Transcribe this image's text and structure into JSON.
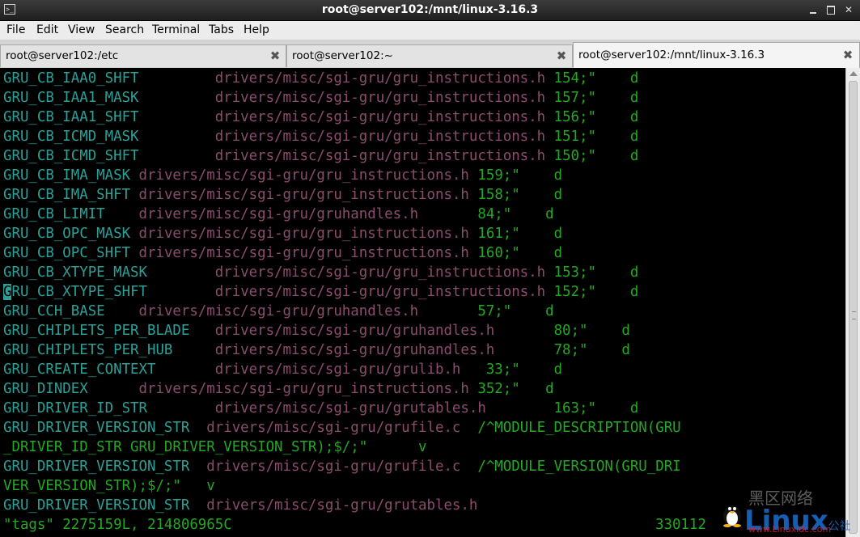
{
  "window": {
    "title": "root@server102:/mnt/linux-3.16.3"
  },
  "menu": {
    "items": [
      "File",
      "Edit",
      "View",
      "Search",
      "Terminal",
      "Tabs",
      "Help"
    ]
  },
  "tabs": [
    {
      "label": "root@server102:/etc",
      "active": false
    },
    {
      "label": "root@server102:~",
      "active": false
    },
    {
      "label": "root@server102:/mnt/linux-3.16.3",
      "active": true
    }
  ],
  "terminal": {
    "lines": [
      {
        "sym": "GRU_CB_IAA0_SHFT",
        "gap1": "         ",
        "file": "drivers/misc/sgi-gru/gru_instructions.h",
        "gap2": " ",
        "num": "154;\"",
        "gap3": "    ",
        "kind": "d"
      },
      {
        "sym": "GRU_CB_IAA1_MASK",
        "gap1": "         ",
        "file": "drivers/misc/sgi-gru/gru_instructions.h",
        "gap2": " ",
        "num": "157;\"",
        "gap3": "    ",
        "kind": "d"
      },
      {
        "sym": "GRU_CB_IAA1_SHFT",
        "gap1": "         ",
        "file": "drivers/misc/sgi-gru/gru_instructions.h",
        "gap2": " ",
        "num": "156;\"",
        "gap3": "    ",
        "kind": "d"
      },
      {
        "sym": "GRU_CB_ICMD_MASK",
        "gap1": "         ",
        "file": "drivers/misc/sgi-gru/gru_instructions.h",
        "gap2": " ",
        "num": "151;\"",
        "gap3": "    ",
        "kind": "d"
      },
      {
        "sym": "GRU_CB_ICMD_SHFT",
        "gap1": "         ",
        "file": "drivers/misc/sgi-gru/gru_instructions.h",
        "gap2": " ",
        "num": "150;\"",
        "gap3": "    ",
        "kind": "d"
      },
      {
        "sym": "GRU_CB_IMA_MASK",
        "gap1": " ",
        "file": "drivers/misc/sgi-gru/gru_instructions.h",
        "gap2": " ",
        "num": "159;\"",
        "gap3": "    ",
        "kind": "d"
      },
      {
        "sym": "GRU_CB_IMA_SHFT",
        "gap1": " ",
        "file": "drivers/misc/sgi-gru/gru_instructions.h",
        "gap2": " ",
        "num": "158;\"",
        "gap3": "    ",
        "kind": "d"
      },
      {
        "sym": "GRU_CB_LIMIT",
        "gap1": "    ",
        "file": "drivers/misc/sgi-gru/gruhandles.h",
        "gap2": "       ",
        "num": "84;\"",
        "gap3": "    ",
        "kind": "d"
      },
      {
        "sym": "GRU_CB_OPC_MASK",
        "gap1": " ",
        "file": "drivers/misc/sgi-gru/gru_instructions.h",
        "gap2": " ",
        "num": "161;\"",
        "gap3": "    ",
        "kind": "d"
      },
      {
        "sym": "GRU_CB_OPC_SHFT",
        "gap1": " ",
        "file": "drivers/misc/sgi-gru/gru_instructions.h",
        "gap2": " ",
        "num": "160;\"",
        "gap3": "    ",
        "kind": "d"
      },
      {
        "sym": "GRU_CB_XTYPE_MASK",
        "gap1": "        ",
        "file": "drivers/misc/sgi-gru/gru_instructions.h",
        "gap2": " ",
        "num": "153;\"",
        "gap3": "    ",
        "kind": "d"
      },
      {
        "sym": "GRU_CB_XTYPE_SHFT",
        "gap1": "        ",
        "file": "drivers/misc/sgi-gru/gru_instructions.h",
        "gap2": " ",
        "num": "152;\"",
        "gap3": "    ",
        "kind": "d",
        "cursor": true
      },
      {
        "sym": "GRU_CCH_BASE",
        "gap1": "    ",
        "file": "drivers/misc/sgi-gru/gruhandles.h",
        "gap2": "       ",
        "num": "57;\"",
        "gap3": "    ",
        "kind": "d"
      },
      {
        "sym": "GRU_CHIPLETS_PER_BLADE",
        "gap1": "   ",
        "file": "drivers/misc/sgi-gru/gruhandles.h",
        "gap2": "       ",
        "num": "80;\"",
        "gap3": "    ",
        "kind": "d"
      },
      {
        "sym": "GRU_CHIPLETS_PER_HUB",
        "gap1": "     ",
        "file": "drivers/misc/sgi-gru/gruhandles.h",
        "gap2": "       ",
        "num": "78;\"",
        "gap3": "    ",
        "kind": "d"
      },
      {
        "sym": "GRU_CREATE_CONTEXT",
        "gap1": "       ",
        "file": "drivers/misc/sgi-gru/grulib.h",
        "gap2": "   ",
        "num": "33;\"",
        "gap3": "    ",
        "kind": "d"
      },
      {
        "sym": "GRU_DINDEX",
        "gap1": "      ",
        "file": "drivers/misc/sgi-gru/gru_instructions.h",
        "gap2": " ",
        "num": "352;\"",
        "gap3": "   ",
        "kind": "d"
      },
      {
        "sym": "GRU_DRIVER_ID_STR",
        "gap1": "        ",
        "file": "drivers/misc/sgi-gru/grutables.h",
        "gap2": "        ",
        "num": "163;\"",
        "gap3": "    ",
        "kind": "d"
      },
      {
        "sym": "GRU_DRIVER_VERSION_STR",
        "gap1": "  ",
        "file": "drivers/misc/sgi-gru/grufile.c",
        "gap2": "  ",
        "num": "/^MODULE_DESCRIPTION(GRU",
        "gap3": "",
        "kind": ""
      },
      {
        "sym": "",
        "gap1": "",
        "file": "",
        "gap2": "",
        "num": "_DRIVER_ID_STR GRU_DRIVER_VERSION_STR);$/;\"",
        "gap3": "      ",
        "kind": "v"
      },
      {
        "sym": "GRU_DRIVER_VERSION_STR",
        "gap1": "  ",
        "file": "drivers/misc/sgi-gru/grufile.c",
        "gap2": "  ",
        "num": "/^MODULE_VERSION(GRU_DRI",
        "gap3": "",
        "kind": ""
      },
      {
        "sym": "",
        "gap1": "",
        "file": "",
        "gap2": "",
        "num": "VER_VERSION_STR);$/;\"",
        "gap3": "   ",
        "kind": "v"
      },
      {
        "sym": "GRU_DRIVER_VERSION_STR",
        "gap1": "  ",
        "file": "drivers/misc/sgi-gru/grutables.h",
        "gap2": "",
        "num": "",
        "gap3": "",
        "kind": ""
      }
    ],
    "status_left": "\"tags\" 2275159L, 214806965C",
    "status_right": "330112"
  },
  "watermark": {
    "site": "Linux",
    "cn": "黑区网络",
    "suffix": "公社",
    "url": "www.Linuxidc.com"
  },
  "colors": {
    "symbol": "#2aa198",
    "file": "#8b4c6e",
    "number": "#22a822",
    "background": "#000000"
  }
}
